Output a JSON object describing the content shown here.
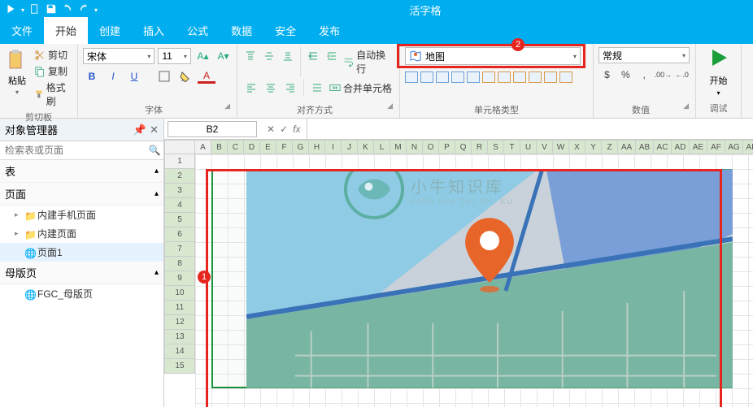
{
  "app": {
    "title": "活字格"
  },
  "menu": {
    "tabs": [
      "文件",
      "开始",
      "创建",
      "插入",
      "公式",
      "数据",
      "安全",
      "发布"
    ],
    "active": 1
  },
  "ribbon": {
    "clipboard": {
      "label": "剪切板",
      "paste": "粘贴",
      "cut": "剪切",
      "copy": "复制",
      "format_painter": "格式刷"
    },
    "font": {
      "label": "字体",
      "family": "宋体",
      "size": "11",
      "bold": "B",
      "italic": "I",
      "underline": "U"
    },
    "align": {
      "label": "对齐方式",
      "wrap": "自动换行",
      "merge": "合并单元格"
    },
    "celltype": {
      "label": "单元格类型",
      "value": "地图"
    },
    "number": {
      "label": "数值",
      "value": "常规"
    },
    "run": {
      "label": "调试",
      "start": "开始"
    }
  },
  "left": {
    "title": "对象管理器",
    "search_ph": "检索表或页面",
    "sections": {
      "tables": "表",
      "pages": "页面",
      "master": "母版页"
    },
    "pages": [
      "内建手机页面",
      "内建页面",
      "页面1"
    ],
    "master_items": [
      "FGC_母版页"
    ]
  },
  "formula": {
    "cell": "B2",
    "fx": "fx"
  },
  "grid": {
    "cols": [
      "A",
      "B",
      "C",
      "D",
      "E",
      "F",
      "G",
      "H",
      "I",
      "J",
      "K",
      "L",
      "M",
      "N",
      "O",
      "P",
      "Q",
      "R",
      "S",
      "T",
      "U",
      "V",
      "W",
      "X",
      "Y",
      "Z",
      "AA",
      "AB",
      "AC",
      "AD",
      "AE",
      "AF",
      "AG",
      "AH"
    ],
    "rows": 15
  },
  "watermark": {
    "text": "小牛知识库",
    "sub": "XIAO NIU ZHI SHI KU"
  }
}
